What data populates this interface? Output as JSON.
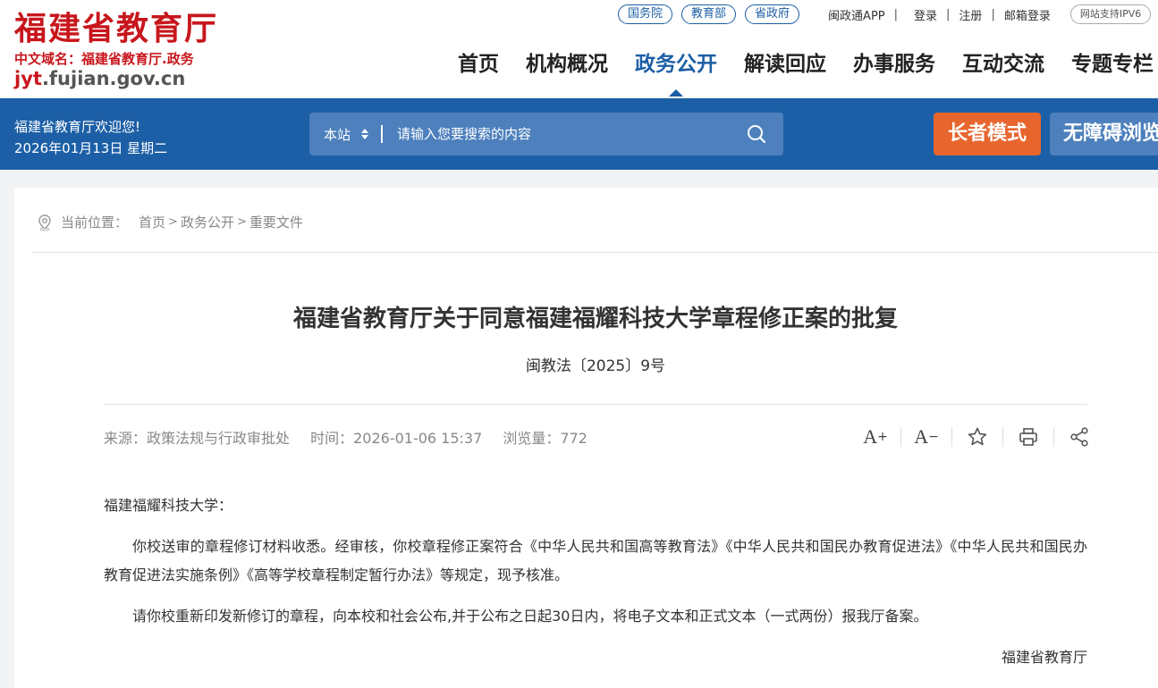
{
  "logo": {
    "title": "福建省教育厅",
    "domain": "中文域名：福建省教育厅.政务",
    "url_main": "jyt",
    "url_rest": ".fujian.gov.cn"
  },
  "top_links": {
    "gov": [
      "国务院",
      "教育部",
      "省政府"
    ],
    "app": "闽政通APP",
    "login": "登录",
    "register": "注册",
    "mail": "邮箱登录",
    "ipv6": "网站支持IPV6"
  },
  "nav": {
    "items": [
      "首页",
      "机构概况",
      "政务公开",
      "解读回应",
      "办事服务",
      "互动交流",
      "专题专栏"
    ],
    "active": "政务公开"
  },
  "bluebar": {
    "welcome": "福建省教育厅欢迎您!",
    "date": "2026年01月13日 星期二",
    "search_scope": "本站",
    "search_placeholder": "请输入您要搜索的内容",
    "elder_mode": "长者模式",
    "accessible": "无障碍浏览"
  },
  "breadcrumb": {
    "label": "当前位置：",
    "items": [
      "首页",
      "政务公开",
      "重要文件"
    ]
  },
  "article": {
    "title": "福建省教育厅关于同意福建福耀科技大学章程修正案的批复",
    "doc_number": "闽教法〔2025〕9号",
    "source": "来源：政策法规与行政审批处",
    "time": "时间：2026-01-06 15:37",
    "views": "浏览量：772",
    "salutation": "福建福耀科技大学：",
    "paragraphs": [
      "你校送审的章程修订材料收悉。经审核，你校章程修正案符合《中华人民共和国高等教育法》《中华人民共和国民办教育促进法》《中华人民共和国民办教育促进法实施条例》《高等学校章程制定暂行办法》等规定，现予核准。",
      "请你校重新印发新修订的章程，向本校和社会公布,并于公布之日起30日内，将电子文本和正式文本（一式两份）报我厅备案。"
    ],
    "signature": "福建省教育厅"
  },
  "colors": {
    "brand_red": "#c8161d",
    "brand_blue": "#1c5fa6",
    "elder_orange": "#e8662e"
  }
}
